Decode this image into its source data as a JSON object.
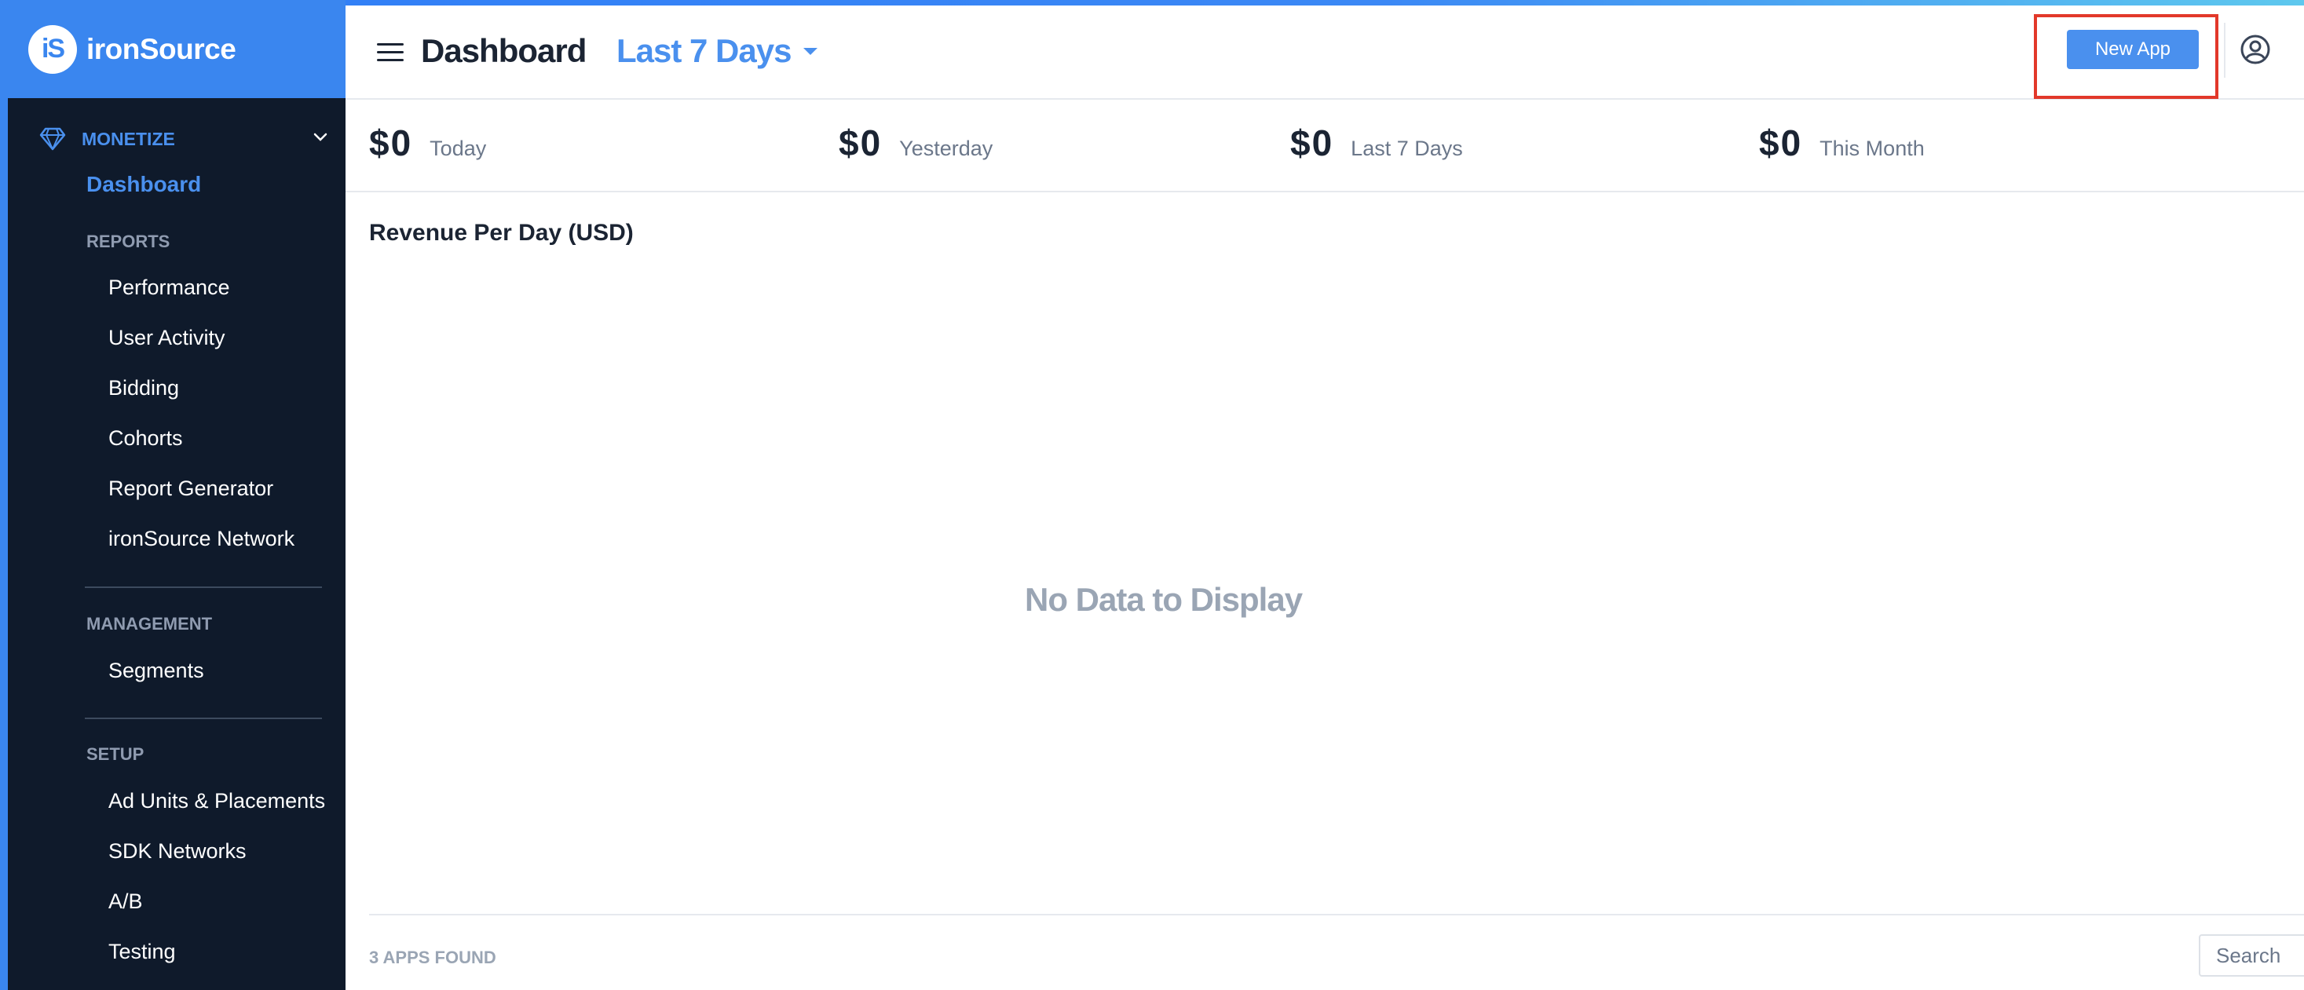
{
  "brand": {
    "badge": "iS",
    "name": "ironSource",
    "accent": "#3a86ef"
  },
  "sidebar": {
    "section_title": "MONETIZE",
    "active_item": "Dashboard",
    "reports": {
      "heading": "REPORTS",
      "items": [
        "Performance",
        "User Activity",
        "Bidding",
        "Cohorts",
        "Report Generator",
        "ironSource Network"
      ]
    },
    "management": {
      "heading": "MANAGEMENT",
      "items": [
        "Segments"
      ]
    },
    "setup": {
      "heading": "SETUP",
      "items": [
        "Ad Units & Placements",
        "SDK Networks",
        "A/B",
        "Testing"
      ]
    }
  },
  "header": {
    "title": "Dashboard",
    "date_range": "Last 7 Days",
    "new_app_label": "New App"
  },
  "stats": [
    {
      "value": "$0",
      "label": "Today"
    },
    {
      "value": "$0",
      "label": "Yesterday"
    },
    {
      "value": "$0",
      "label": "Last 7 Days"
    },
    {
      "value": "$0",
      "label": "This Month"
    }
  ],
  "chart": {
    "title": "Revenue Per Day (USD)",
    "empty_message": "No Data to Display"
  },
  "apps": {
    "count_label": "3 APPS FOUND",
    "search_placeholder": "Search"
  },
  "colors": {
    "primary": "#4a90ee",
    "sidebar_bg": "#0f1a2b",
    "highlight": "#e2382a",
    "text_dark": "#1b2433",
    "text_muted": "#9aa5b4"
  }
}
